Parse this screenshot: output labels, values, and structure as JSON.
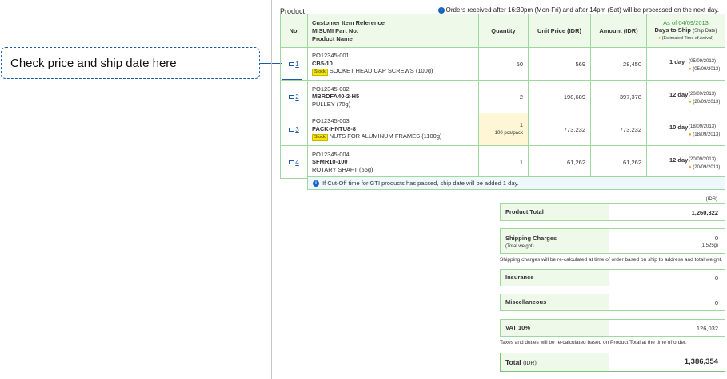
{
  "callout": {
    "text": "Check price and ship date here"
  },
  "panel": {
    "product_label": "Product",
    "notice": "Orders received after 16:30pm (Mon-Fri) and after 14pm (Sat) will be processed on the next day."
  },
  "table": {
    "headers": {
      "no": "No.",
      "ref1": "Customer Item Reference",
      "ref2": "MISUMI Part No.",
      "ref3": "Product Name",
      "qty": "Quantity",
      "unit": "Unit Price (IDR)",
      "amount": "Amount (IDR)",
      "asof": "As of 04/09/2013",
      "days": "Days to Ship",
      "ship_date": "(Ship Date)",
      "est": "(Estimated Time of Arrival)"
    },
    "rows": [
      {
        "no": "1",
        "ref": "PO12345-001",
        "part": "CB5-10",
        "stock": "Stock",
        "name": "SOCKET HEAD CAP SCREWS (100g)",
        "qty": "50",
        "pcs": "",
        "unit": "569",
        "amount": "28,450",
        "days": "1 day",
        "ship": "(05/09/2013)",
        "eta": "(05/09/2013)"
      },
      {
        "no": "2",
        "ref": "PO12345-002",
        "part": "MBRDFA40-2-H5",
        "stock": "",
        "name": "PULLEY (70g)",
        "qty": "2",
        "pcs": "",
        "unit": "198,689",
        "amount": "397,378",
        "days": "12 day",
        "ship": "(20/09/2013)",
        "eta": "(20/09/2013)"
      },
      {
        "no": "3",
        "ref": "PO12345-003",
        "part": "PACK-HNTU8-8",
        "stock": "Stock",
        "name": "NUTS FOR ALUMINUM FRAMES (1100g)",
        "qty": "1",
        "pcs": "100 pcs/pack",
        "unit": "773,232",
        "amount": "773,232",
        "days": "10 day",
        "ship": "(18/09/2013)",
        "eta": "(18/09/2013)"
      },
      {
        "no": "4",
        "ref": "PO12345-004",
        "part": "SFMR10-100",
        "stock": "",
        "name": "ROTARY SHAFT (55g)",
        "qty": "1",
        "pcs": "",
        "unit": "61,262",
        "amount": "61,262",
        "days": "12 day",
        "ship": "(20/09/2013)",
        "eta": "(20/09/2013)"
      }
    ],
    "cutoff_note": "If Cut-Off time for GTI products has passed, ship date will be added 1 day."
  },
  "summary": {
    "currency": "(IDR)",
    "product_total_label": "Product Total",
    "product_total": "1,260,322",
    "shipping_label": "Shipping Charges",
    "total_weight_label": "(Total weight)",
    "shipping": "0",
    "weight": "(1,525g)",
    "shipping_note": "Shipping charges will be re-calculated at time of order based on ship to address and total weight.",
    "insurance_label": "Insurance",
    "insurance": "0",
    "misc_label": "Miscellaneous",
    "misc": "0",
    "vat_label": "VAT 10%",
    "vat": "126,032",
    "tax_note": "Taxes and duties will be re-calculated based on Product Total at the time of order.",
    "total_label": "Total",
    "total_currency": "(IDR)",
    "total": "1,386,354"
  },
  "colors": {
    "accent": "#1e5aa8",
    "header_bg": "#eef9ea",
    "border": "#9fd89f",
    "stock": "#f7e600"
  }
}
